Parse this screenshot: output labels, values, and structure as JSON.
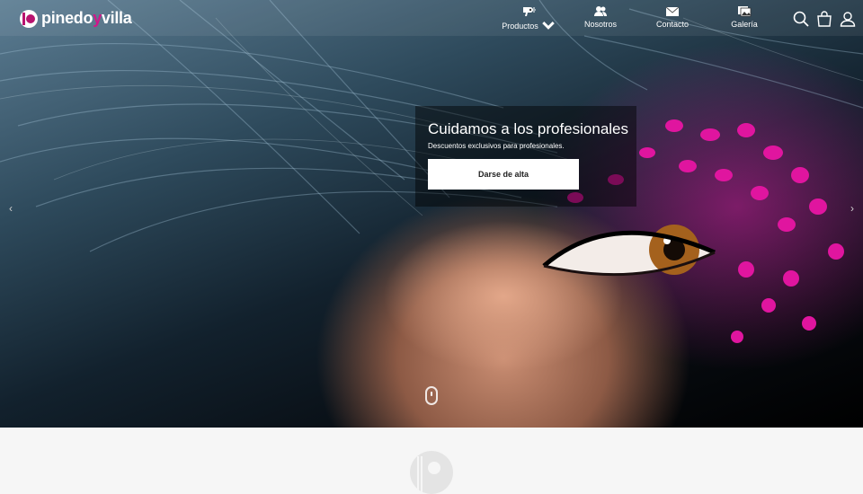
{
  "header": {
    "logo_left": "pinedo",
    "logo_mid": "y",
    "logo_right": "villa"
  },
  "nav": [
    {
      "label": "Productos",
      "icon": "dryer-icon",
      "has_dropdown": true
    },
    {
      "label": "Nosotros",
      "icon": "people-icon"
    },
    {
      "label": "Contacto",
      "icon": "envelope-icon"
    },
    {
      "label": "Galería",
      "icon": "gallery-icon"
    }
  ],
  "actions": {
    "search": "search-icon",
    "cart": "shopping-bag-icon",
    "account": "user-icon"
  },
  "slide": {
    "title": "Cuidamos a los profesionales",
    "subtitle": "Descuentos exclusivos para profesionales.",
    "cta": "Darse de alta"
  },
  "carousel": {
    "prev": "‹",
    "next": "›"
  },
  "colors": {
    "brand": "#d1168a",
    "feather": "#e0159f"
  }
}
